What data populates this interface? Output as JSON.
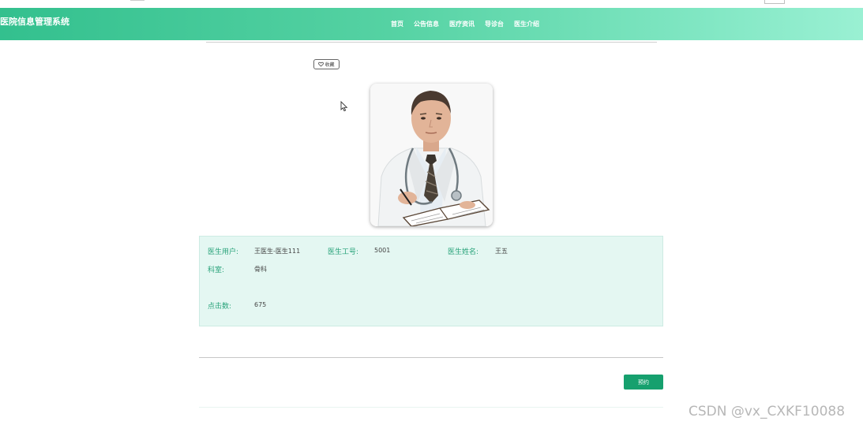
{
  "site": {
    "title": "医院信息管理系统"
  },
  "nav": {
    "items": [
      "首页",
      "公告信息",
      "医疗资讯",
      "导诊台",
      "医生介绍"
    ]
  },
  "actions": {
    "favorite_label": "收藏",
    "book_label": "预约"
  },
  "doctor": {
    "user_label": "医生用户:",
    "user_value": "王医生-医生111",
    "id_label": "医生工号:",
    "id_value": "5001",
    "name_label": "医生姓名:",
    "name_value": "王五",
    "dept_label": "科室:",
    "dept_value": "骨科",
    "clicks_label": "点击数:",
    "clicks_value": "675"
  },
  "watermark": "CSDN @vx_CXKF10088",
  "colors": {
    "brand_green": "#16a06e",
    "label_green": "#27a279",
    "info_bg": "#e4f7f2"
  }
}
